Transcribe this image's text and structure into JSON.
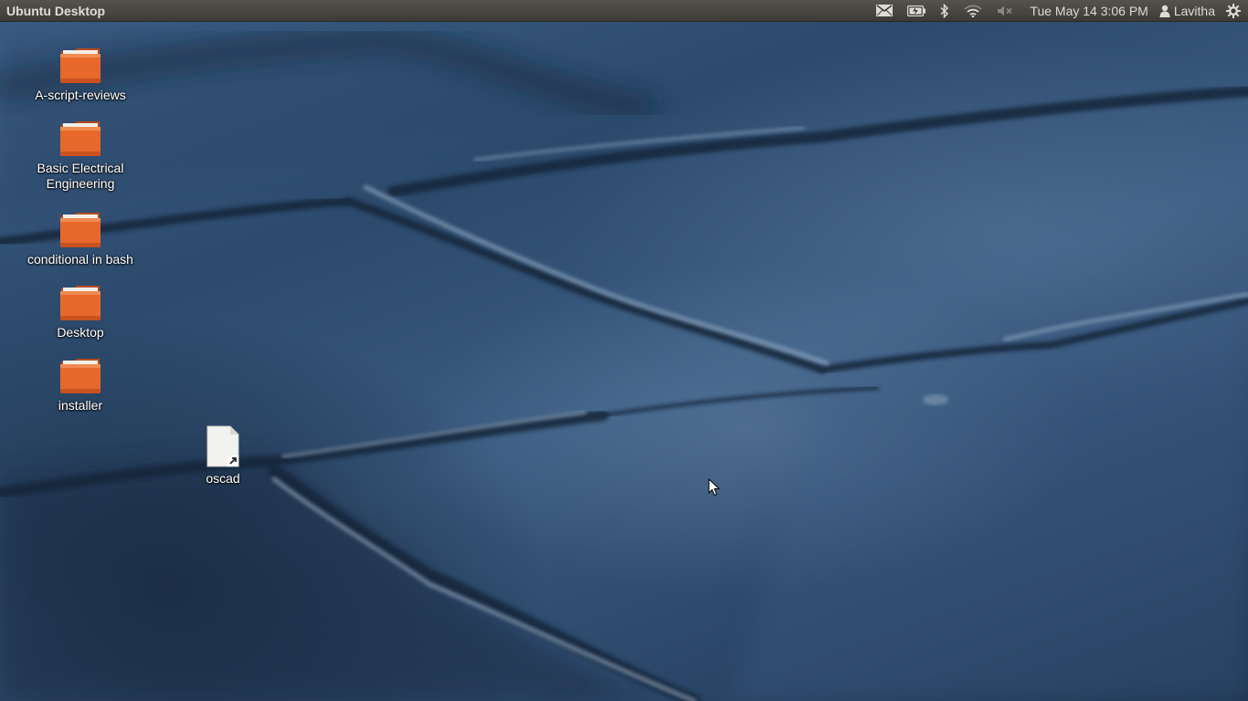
{
  "panel": {
    "title": "Ubuntu Desktop",
    "indicators": {
      "mail": "envelope-icon",
      "battery": "battery-icon",
      "bluetooth": "bluetooth-icon",
      "network": "wifi-icon",
      "sound": "speaker-muted-icon",
      "session": "gear-icon"
    },
    "clock": "Tue May 14  3:06 PM",
    "user": "Lavitha"
  },
  "desktop": {
    "icons": [
      {
        "label": "A-script-reviews",
        "type": "folder"
      },
      {
        "label": "Basic Electrical Engineering",
        "type": "folder"
      },
      {
        "label": "conditional in bash",
        "type": "folder"
      },
      {
        "label": "Desktop",
        "type": "folder"
      },
      {
        "label": "installer",
        "type": "folder"
      },
      {
        "label": "oscad",
        "type": "file-link"
      }
    ]
  },
  "colors": {
    "panel_bg": "#3c3b37",
    "folder_orange": "#e8682c",
    "wallpaper_blue": "#2c4a6c"
  }
}
